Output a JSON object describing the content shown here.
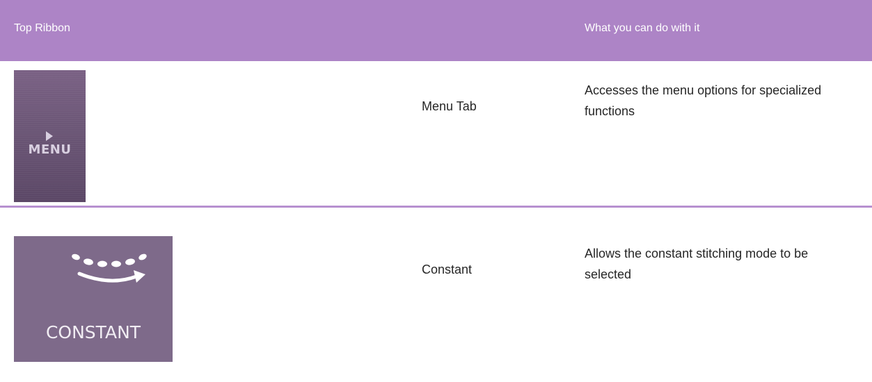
{
  "header": {
    "col1": "Top Ribbon",
    "col3": "What you can do with it"
  },
  "rows": [
    {
      "icon": "menu-tab-icon",
      "icon_label": "MENU",
      "name": "Menu Tab",
      "description": "Accesses the menu options for specialized functions"
    },
    {
      "icon": "constant-stitch-icon",
      "icon_label": "CONSTANT",
      "name": "Constant",
      "description": "Allows the constant stitching mode to be selected"
    }
  ],
  "colors": {
    "header_bg": "#ad84c6",
    "divider": "#b790d0",
    "menu_tab_bg": "#6b5676",
    "constant_bg": "#7e6a8a"
  }
}
